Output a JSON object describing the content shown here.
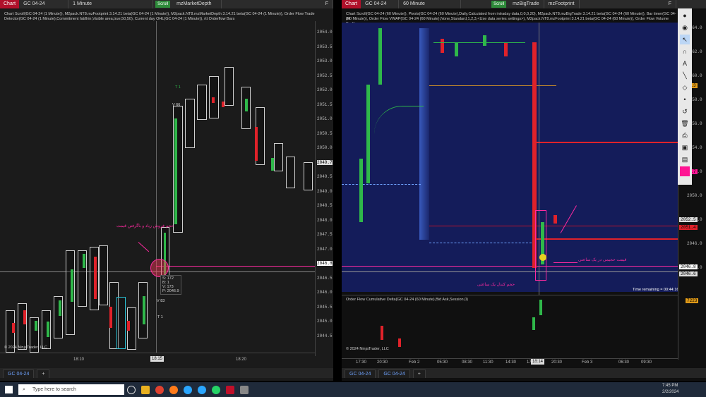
{
  "left_chart": {
    "tag": "Chart",
    "instrument": "GC 04-24",
    "interval": "1 Minute",
    "scroll_label": "Scroll",
    "indicator": "mzMarketDepth",
    "flag": "F",
    "info_line1": "Chart Scroll(GC 04-24 (1 Minute)), M2pack.NT8.mzFootprint 3.14.21 beta(GC 04-24 (1 Minute)), M2pack.NT8.mzMarketDepth 3.14.21 beta(GC 04-24 (1 Minute)), Order Flow Trade",
    "info_line2": "Detector(GC 04-24 (1 Minute),Commitment fat/thin,Visible area,true,50,50), Current day OHL(GC 04-24 (1 Minute)), rtt Orderflow Bars",
    "y_labels": [
      "2054.0",
      "2053.5",
      "2053.0",
      "2052.5",
      "2052.0",
      "2051.5",
      "2051.0",
      "2050.5",
      "2050.0",
      "2049.7",
      "2049.5",
      "2049.0",
      "2048.5",
      "2048.0",
      "2047.5",
      "2047.0",
      "2046.8",
      "2046.5",
      "2046.0",
      "2045.5",
      "2045.0",
      "2044.5"
    ],
    "x_labels": [
      "18:10",
      "18:15",
      "18:20"
    ],
    "annotation": "حجم فروش زیاد و باگرفتن قیمت",
    "copyright": "© 2024 NinjaTrader, LLC",
    "t1_label": "T 1",
    "v66": "V 66",
    "v83": "V 83",
    "s172": "S: 172",
    "b1": "B: 1",
    "v173": "V: 173",
    "p": "P: 2046.9",
    "tab": "GC 04-24",
    "add_tab": "+"
  },
  "right_chart": {
    "tag": "Chart",
    "instrument": "GC 04-24",
    "interval": "60 Minute",
    "scroll_label": "Scroll",
    "indicator1": "mzBigTrade",
    "indicator2": "mzFootprint",
    "flag": "F",
    "info_line1": "Chart Scroll(GC 04-24 (60 Minute)), Pivots(GC 04-24 (60 Minute),Daily,Calculated from intraday data,0,0,0,20), M2pack.NT8.mzBigTrade 3.14.21 beta(GC 04-24 (60 Minute)), Bar timer(GC 04-24",
    "info_line2": "(60 Minute)), Order Flow VWAP(GC 04-24 (60 Minute),None,Standard,1,2,3,<Use data series settings>), M2pack.NT8.mzFootprint 3.14.21 beta(GC 04-24 (60 Minute)), Order Flow Volume Profile",
    "y_labels": [
      "2064.0",
      "2062.0",
      "2060.0",
      "2058.0",
      "2056.0",
      "2054.0",
      "2052.0",
      "2050.0",
      "2048.0",
      "2046.0",
      "2044.0"
    ],
    "price_badges": [
      "2057.3",
      "2057.7",
      "2052.5",
      "2051.4",
      "2046.8",
      "2046.6"
    ],
    "x_labels": [
      "17:30",
      "20:30",
      "Feb 2",
      "05:30",
      "08:30",
      "11:30",
      "14:30",
      "17:30",
      "20:30",
      "Feb 3",
      "06:30",
      "09:30"
    ],
    "x_cursor": "18:14",
    "time_remaining": "Time remaining = 00:44:16",
    "annot1": "قیمت حجیمی در یک ساعتی",
    "annot2": "حجم کندل یک ساعتی",
    "sub_title": "Order Flow Cumulative Delta(GC 04-24 (60 Minute),Bid Ask,Session,0)",
    "sub_value": "7223",
    "copyright": "© 2024 NinjaTrader, LLC",
    "tabs": [
      "GC 04-24",
      "GC 04-24"
    ],
    "add_tab": "+"
  },
  "taskbar": {
    "search_placeholder": "Type here to search",
    "time": "7:45 PM",
    "date": "2/2/2024"
  },
  "colors": {
    "up": "#2fb84a",
    "down": "#e0222a",
    "pink": "#ff2aa0",
    "navy": "#141c5a",
    "tag": "#b0102a"
  }
}
